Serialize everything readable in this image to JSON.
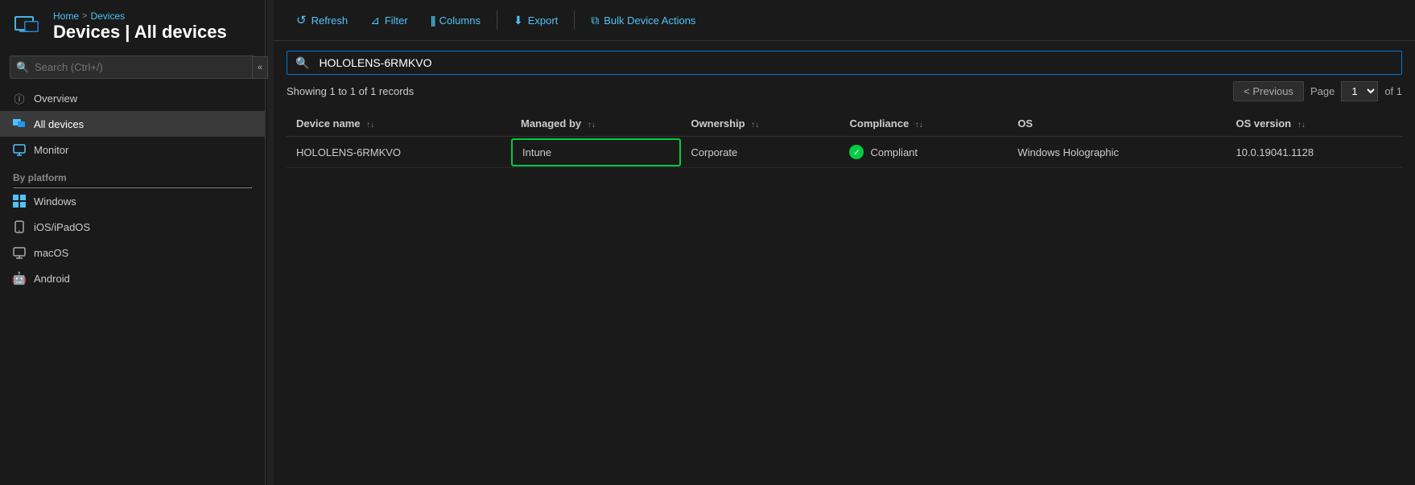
{
  "breadcrumb": {
    "home": "Home",
    "separator": ">",
    "current": "Devices"
  },
  "page": {
    "title": "Devices | All devices"
  },
  "sidebar": {
    "search_placeholder": "Search (Ctrl+/)",
    "nav_items": [
      {
        "id": "overview",
        "label": "Overview",
        "icon": "info-circle",
        "active": false
      },
      {
        "id": "all-devices",
        "label": "All devices",
        "icon": "devices",
        "active": true
      },
      {
        "id": "monitor",
        "label": "Monitor",
        "icon": "monitor",
        "active": false
      }
    ],
    "section_label": "By platform",
    "platform_items": [
      {
        "id": "windows",
        "label": "Windows",
        "icon": "windows"
      },
      {
        "id": "ios",
        "label": "iOS/iPadOS",
        "icon": "ios"
      },
      {
        "id": "macos",
        "label": "macOS",
        "icon": "macos"
      },
      {
        "id": "android",
        "label": "Android",
        "icon": "android"
      }
    ]
  },
  "toolbar": {
    "refresh_label": "Refresh",
    "filter_label": "Filter",
    "columns_label": "Columns",
    "export_label": "Export",
    "bulk_actions_label": "Bulk Device Actions"
  },
  "search": {
    "value": "HOLOLENS-6RMKVO",
    "placeholder": "Search"
  },
  "records_info": "Showing 1 to 1 of 1 records",
  "pagination": {
    "previous_label": "< Previous",
    "page_label": "Page",
    "page_value": "1",
    "of_label": "of 1"
  },
  "table": {
    "columns": [
      {
        "id": "device-name",
        "label": "Device name"
      },
      {
        "id": "managed-by",
        "label": "Managed by"
      },
      {
        "id": "ownership",
        "label": "Ownership"
      },
      {
        "id": "compliance",
        "label": "Compliance"
      },
      {
        "id": "os",
        "label": "OS"
      },
      {
        "id": "os-version",
        "label": "OS version"
      }
    ],
    "rows": [
      {
        "device_name": "HOLOLENS-6RMKVO",
        "managed_by": "Intune",
        "ownership": "Corporate",
        "compliance": "Compliant",
        "os": "Windows Holographic",
        "os_version": "10.0.19041.1128"
      }
    ]
  }
}
